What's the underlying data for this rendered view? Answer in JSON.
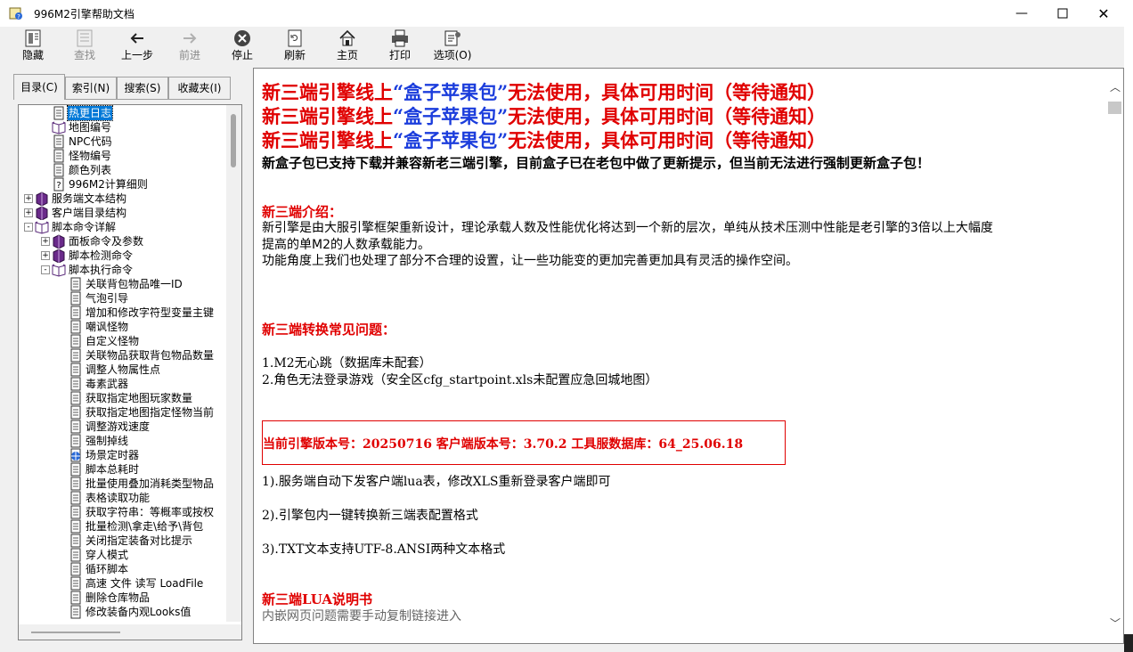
{
  "window": {
    "title": "996M2引擎帮助文档"
  },
  "toolbar": {
    "hide": "隐藏",
    "find": "查找",
    "back": "上一步",
    "forward": "前进",
    "stop": "停止",
    "refresh": "刷新",
    "home": "主页",
    "print": "打印",
    "options": "选项(O)"
  },
  "tabs": [
    "目录(C)",
    "索引(N)",
    "搜索(S)",
    "收藏夹(I)"
  ],
  "tree": [
    {
      "label": "热更日志",
      "icon": "page-icon",
      "selected": true
    },
    {
      "label": "地图编号",
      "icon": "book-open-icon"
    },
    {
      "label": "NPC代码",
      "icon": "page-icon"
    },
    {
      "label": "怪物编号",
      "icon": "page-icon"
    },
    {
      "label": "颜色列表",
      "icon": "page-icon"
    },
    {
      "label": "996M2计算细则",
      "icon": "help-page-icon"
    },
    {
      "label": "服务端文本结构",
      "icon": "book-icon"
    },
    {
      "label": "客户端目录结构",
      "icon": "book-icon"
    },
    {
      "label": "脚本命令详解",
      "icon": "book-open-icon"
    },
    {
      "label": "面板命令及参数",
      "icon": "book-icon"
    },
    {
      "label": "脚本检测命令",
      "icon": "book-icon"
    },
    {
      "label": "脚本执行命令",
      "icon": "book-open-icon"
    },
    {
      "label": "关联背包物品唯一ID",
      "icon": "page-icon"
    },
    {
      "label": "气泡引导",
      "icon": "page-icon"
    },
    {
      "label": "增加和修改字符型变量主键",
      "icon": "page-icon"
    },
    {
      "label": "嘲讽怪物",
      "icon": "page-icon"
    },
    {
      "label": "自定义怪物",
      "icon": "page-icon"
    },
    {
      "label": "关联物品获取背包物品数量",
      "icon": "page-icon"
    },
    {
      "label": "调整人物属性点",
      "icon": "page-icon"
    },
    {
      "label": "毒素武器",
      "icon": "page-icon"
    },
    {
      "label": "获取指定地图玩家数量",
      "icon": "page-icon"
    },
    {
      "label": "获取指定地图指定怪物当前",
      "icon": "page-icon"
    },
    {
      "label": "调整游戏速度",
      "icon": "page-icon"
    },
    {
      "label": "强制掉线",
      "icon": "page-icon"
    },
    {
      "label": "场景定时器",
      "icon": "globe-page-icon"
    },
    {
      "label": "脚本总耗时",
      "icon": "page-icon"
    },
    {
      "label": "批量使用叠加消耗类型物品",
      "icon": "page-icon"
    },
    {
      "label": "表格读取功能",
      "icon": "page-icon"
    },
    {
      "label": "获取字符串：等概率或按权",
      "icon": "page-icon"
    },
    {
      "label": "批量检测\\拿走\\给予\\背包",
      "icon": "page-icon"
    },
    {
      "label": "关闭指定装备对比提示",
      "icon": "page-icon"
    },
    {
      "label": "穿人模式",
      "icon": "page-icon"
    },
    {
      "label": "循环脚本",
      "icon": "page-icon"
    },
    {
      "label": "高速 文件 读写 LoadFile",
      "icon": "page-icon"
    },
    {
      "label": "删除仓库物品",
      "icon": "page-icon"
    },
    {
      "label": "修改装备内观Looks值",
      "icon": "page-icon"
    }
  ],
  "content": {
    "warn_prefix": "新三端引擎线上",
    "warn_quote": "“盒子苹果包”",
    "warn_suffix": "无法使用，具体可用时间（等待通知）",
    "notice": "新盒子包已支持下载并兼容新老三端引擎，目前盒子已在老包中做了更新提示，但当前无法进行强制更新盒子包！",
    "intro_title": "新三端介绍：",
    "intro_p1_l1": "新引擎是由大服引擎框架重新设计，理论承载人数及性能优化将达到一个新的层次，单纯从技术压测中性能是老引擎的3倍以上大幅度",
    "intro_p1_l2": "提高的单M2的人数承载能力。",
    "intro_p2": "功能角度上我们也处理了部分不合理的设置，让一些功能变的更加完善更加具有灵活的操作空间。",
    "faq_title": "新三端转换常见问题：",
    "faq1": "1.M2无心跳（数据库未配套）",
    "faq2": "2.角色无法登录游戏（安全区cfg_startpoint.xls未配置应急回城地图）",
    "version": "当前引擎版本号：20250716   客户端版本号：3.70.2   工具服数据库：64_25.06.18",
    "item1": "1).服务端自动下发客户端lua表，修改XLS重新登录客户端即可",
    "item2": "2).引擎包内一键转换新三端表配置格式",
    "item3": "3).TXT文本支持UTF-8.ANSI两种文本格式",
    "lua_title": "新三端LUA说明书",
    "lua_note": "内嵌网页问题需要手动复制链接进入"
  }
}
